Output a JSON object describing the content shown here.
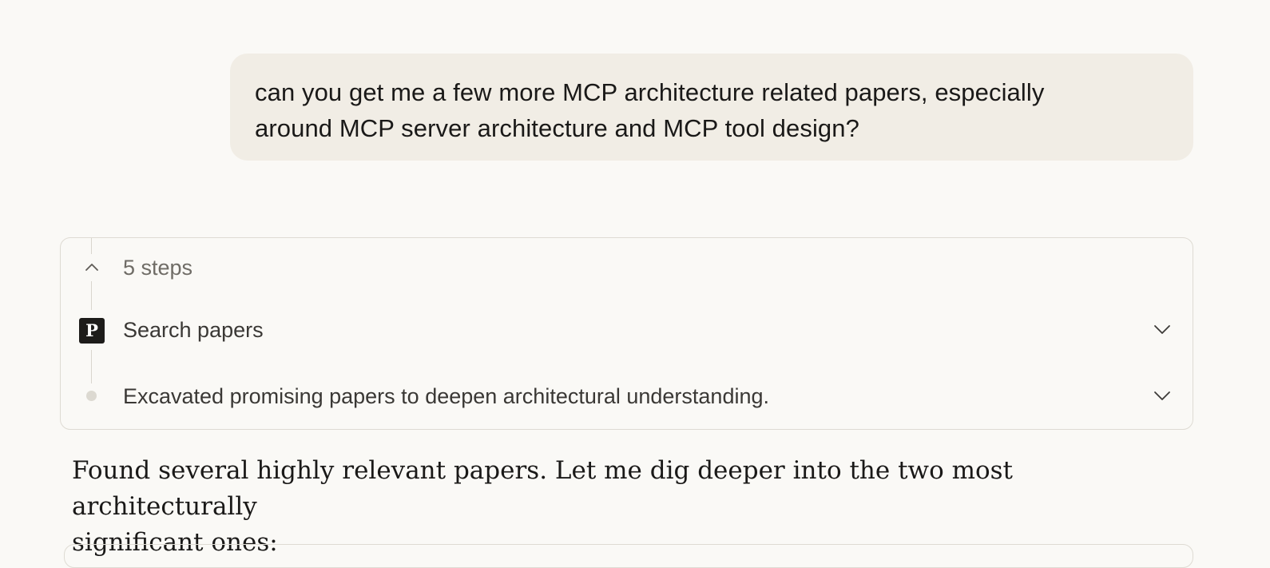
{
  "user_message": {
    "line1": "can you get me a few more MCP architecture related papers, especially",
    "line2": "around MCP server architecture and MCP tool design?"
  },
  "steps_panel": {
    "summary_label": "5 steps",
    "toggle_icon": "chevron-up-icon",
    "steps": [
      {
        "icon": "papers-app-icon",
        "icon_letter": "P",
        "label": "Search papers",
        "expand_icon": "chevron-down-icon"
      },
      {
        "icon": "dot-icon",
        "label": "Excavated promising papers to deepen architectural understanding.",
        "expand_icon": "chevron-down-icon"
      }
    ]
  },
  "assistant_message": {
    "line1": "Found several highly relevant papers. Let me dig deeper into the two most architecturally",
    "line2": "significant ones:"
  },
  "colors": {
    "page_background": "#faf9f6",
    "user_bubble": "#f1ede5",
    "card_border": "#dedbd3",
    "text_primary": "#1a1918",
    "text_muted": "#6f6c66",
    "icon_dark": "#1d1c1a"
  }
}
